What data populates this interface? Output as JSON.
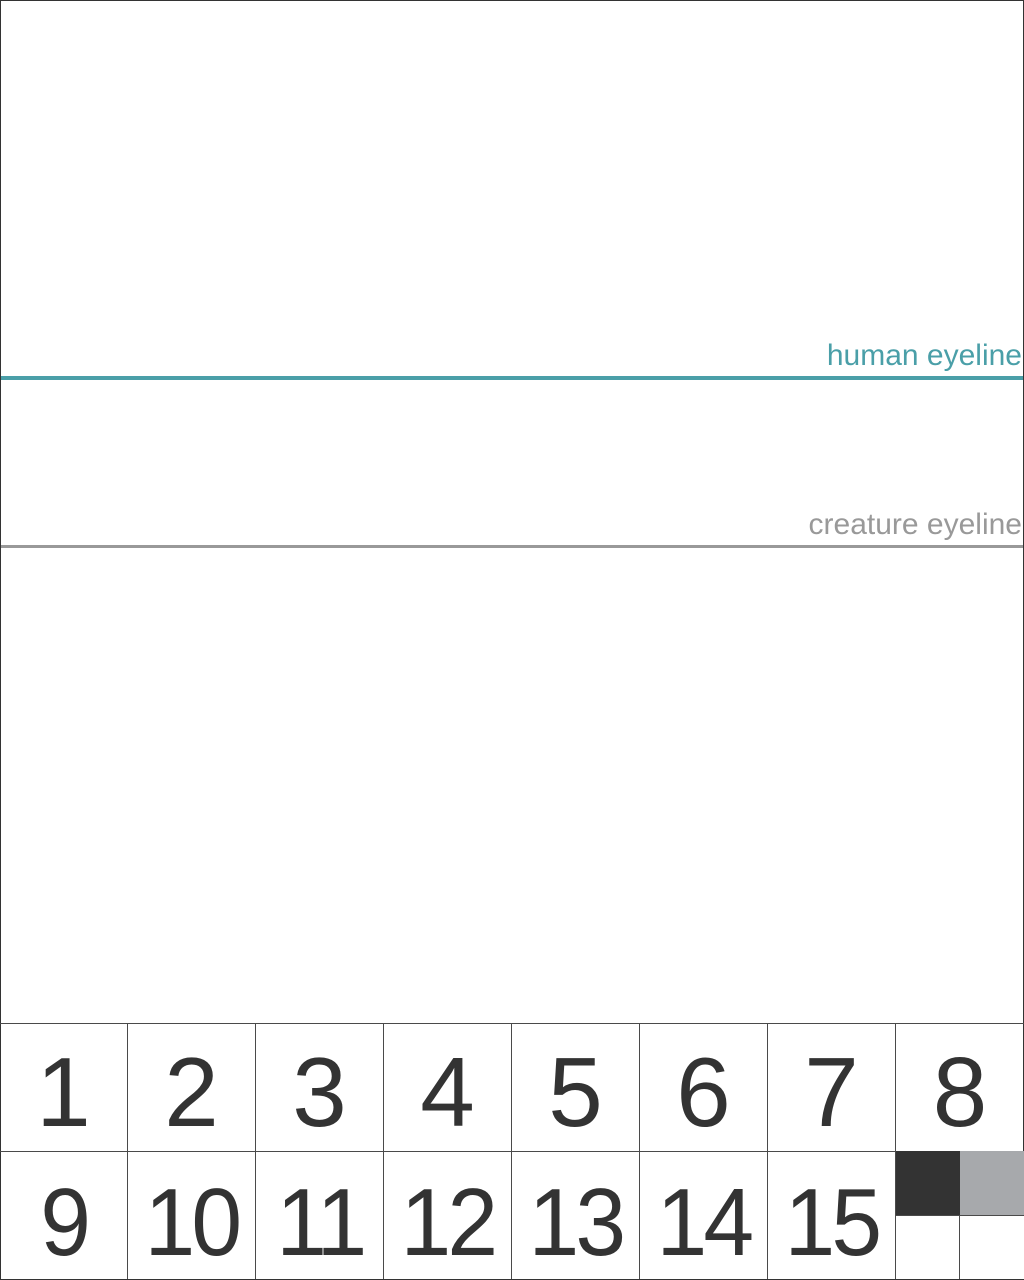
{
  "guides": {
    "human": {
      "label": "human eyeline",
      "color": "#4a9fa8"
    },
    "creature": {
      "label": "creature eyeline",
      "color": "#999999"
    }
  },
  "cells": {
    "row1": [
      "1",
      "2",
      "3",
      "4",
      "5",
      "6",
      "7",
      "8"
    ],
    "row2": [
      "9",
      "10",
      "11",
      "12",
      "13",
      "14",
      "15"
    ]
  },
  "swatches": {
    "dark": "#333333",
    "gray": "#a7a9ac",
    "white1": "#ffffff",
    "white2": "#ffffff"
  }
}
